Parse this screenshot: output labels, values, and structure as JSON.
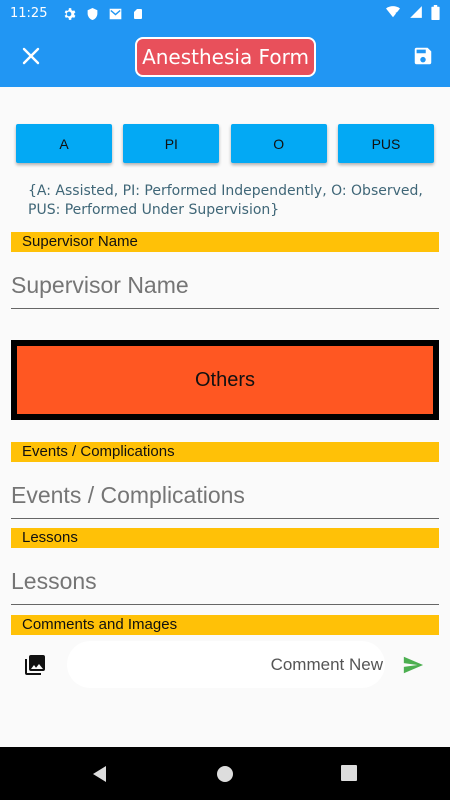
{
  "status_bar": {
    "time": "11:25",
    "icons": [
      "gear-icon",
      "shield-icon",
      "mail-icon",
      "sd-card-icon"
    ],
    "right_icons": [
      "wifi-icon",
      "signal-icon",
      "battery-icon"
    ]
  },
  "app_bar": {
    "title": "Anesthesia Form",
    "close_icon": "close-icon",
    "save_icon": "save-icon",
    "color": "#2196f3",
    "title_bg": "#e8505b"
  },
  "roles": [
    {
      "label": "A"
    },
    {
      "label": "PI"
    },
    {
      "label": "O"
    },
    {
      "label": "PUS"
    }
  ],
  "legend_text": "{A: Assisted, PI: Performed Independently, O: Observed, PUS: Performed Under Supervision}",
  "supervisor": {
    "label": "Supervisor Name",
    "placeholder": "Supervisor Name"
  },
  "others_button": {
    "label": "Others",
    "color": "#ff5722"
  },
  "events": {
    "label": "Events / Complications",
    "placeholder": "Events / Complications"
  },
  "lessons": {
    "label": "Lessons",
    "placeholder": "Lessons"
  },
  "comments": {
    "label": "Comments and Images",
    "placeholder": "Comment New",
    "send_color": "#4caf50"
  },
  "nav": {
    "back_icon": "back-icon",
    "home_icon": "home-icon",
    "recents_icon": "recents-icon"
  }
}
